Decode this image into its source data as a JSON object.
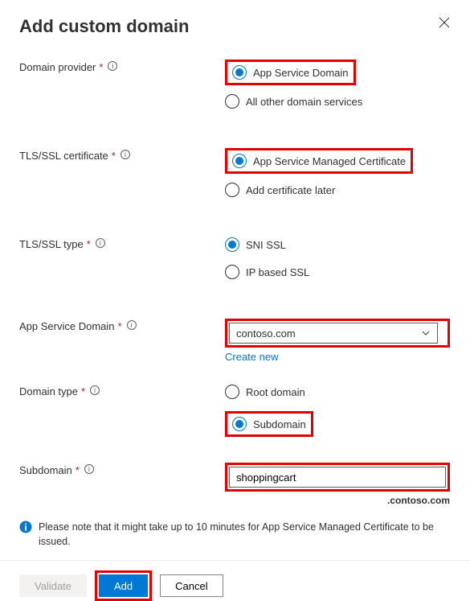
{
  "title": "Add custom domain",
  "fields": {
    "domainProvider": {
      "label": "Domain provider",
      "option1": "App Service Domain",
      "option2": "All other domain services"
    },
    "tlsCert": {
      "label": "TLS/SSL certificate",
      "option1": "App Service Managed Certificate",
      "option2": "Add certificate later"
    },
    "tlsType": {
      "label": "TLS/SSL type",
      "option1": "SNI SSL",
      "option2": "IP based SSL"
    },
    "appServiceDomain": {
      "label": "App Service Domain",
      "value": "contoso.com",
      "createNew": "Create new"
    },
    "domainType": {
      "label": "Domain type",
      "option1": "Root domain",
      "option2": "Subdomain"
    },
    "subdomain": {
      "label": "Subdomain",
      "value": "shoppingcart",
      "suffix": ".contoso.com"
    }
  },
  "note": "Please note that it might take up to 10 minutes for App Service Managed Certificate to be issued.",
  "buttons": {
    "validate": "Validate",
    "add": "Add",
    "cancel": "Cancel"
  }
}
